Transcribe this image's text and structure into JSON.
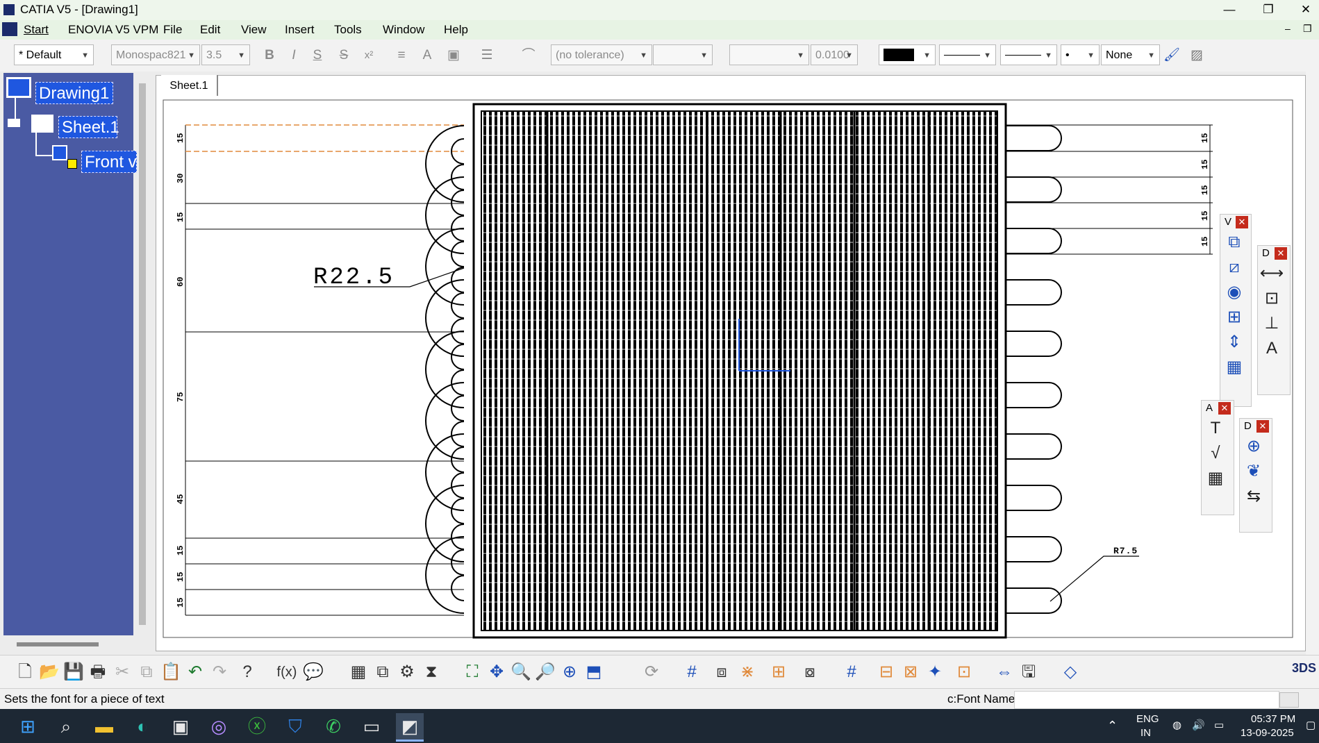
{
  "window": {
    "title": "CATIA V5 - [Drawing1]",
    "minimize": "—",
    "maximize": "❐",
    "close": "✕"
  },
  "menu": {
    "start": "Start",
    "enovia": "ENOVIA V5 VPM",
    "file": "File",
    "edit": "Edit",
    "view": "View",
    "insert": "Insert",
    "tools": "Tools",
    "window": "Window",
    "help": "Help"
  },
  "toolbar": {
    "style": "* Default",
    "font_name": "Monospac821",
    "font_size": "3.5",
    "bold": "B",
    "italic": "I",
    "underline": "S",
    "strike": "S",
    "superscript": "x²",
    "tolerance": "(no tolerance)",
    "precision": "0.0100",
    "pattern": "None"
  },
  "tree": {
    "root": "Drawing1",
    "sheet": "Sheet.1",
    "view": "Front v"
  },
  "sheet_tab": "Sheet.1",
  "drawing": {
    "left_dims": [
      "15",
      "30",
      "15",
      "60",
      "75",
      "45",
      "15",
      "15",
      "15"
    ],
    "right_dims": [
      "15",
      "15",
      "15",
      "15",
      "15"
    ],
    "radius_big": "R22.5",
    "radius_small": "R7.5"
  },
  "palettes": {
    "p1": "V",
    "p2": "D",
    "p3": "A",
    "p4": "D"
  },
  "status": {
    "message": "Sets the font for a piece of text",
    "command_label": "c:Font Name",
    "command_value": ""
  },
  "taskbar": {
    "lang1": "ENG",
    "lang2": "IN",
    "time": "05:37 PM",
    "date": "13-09-2025"
  }
}
